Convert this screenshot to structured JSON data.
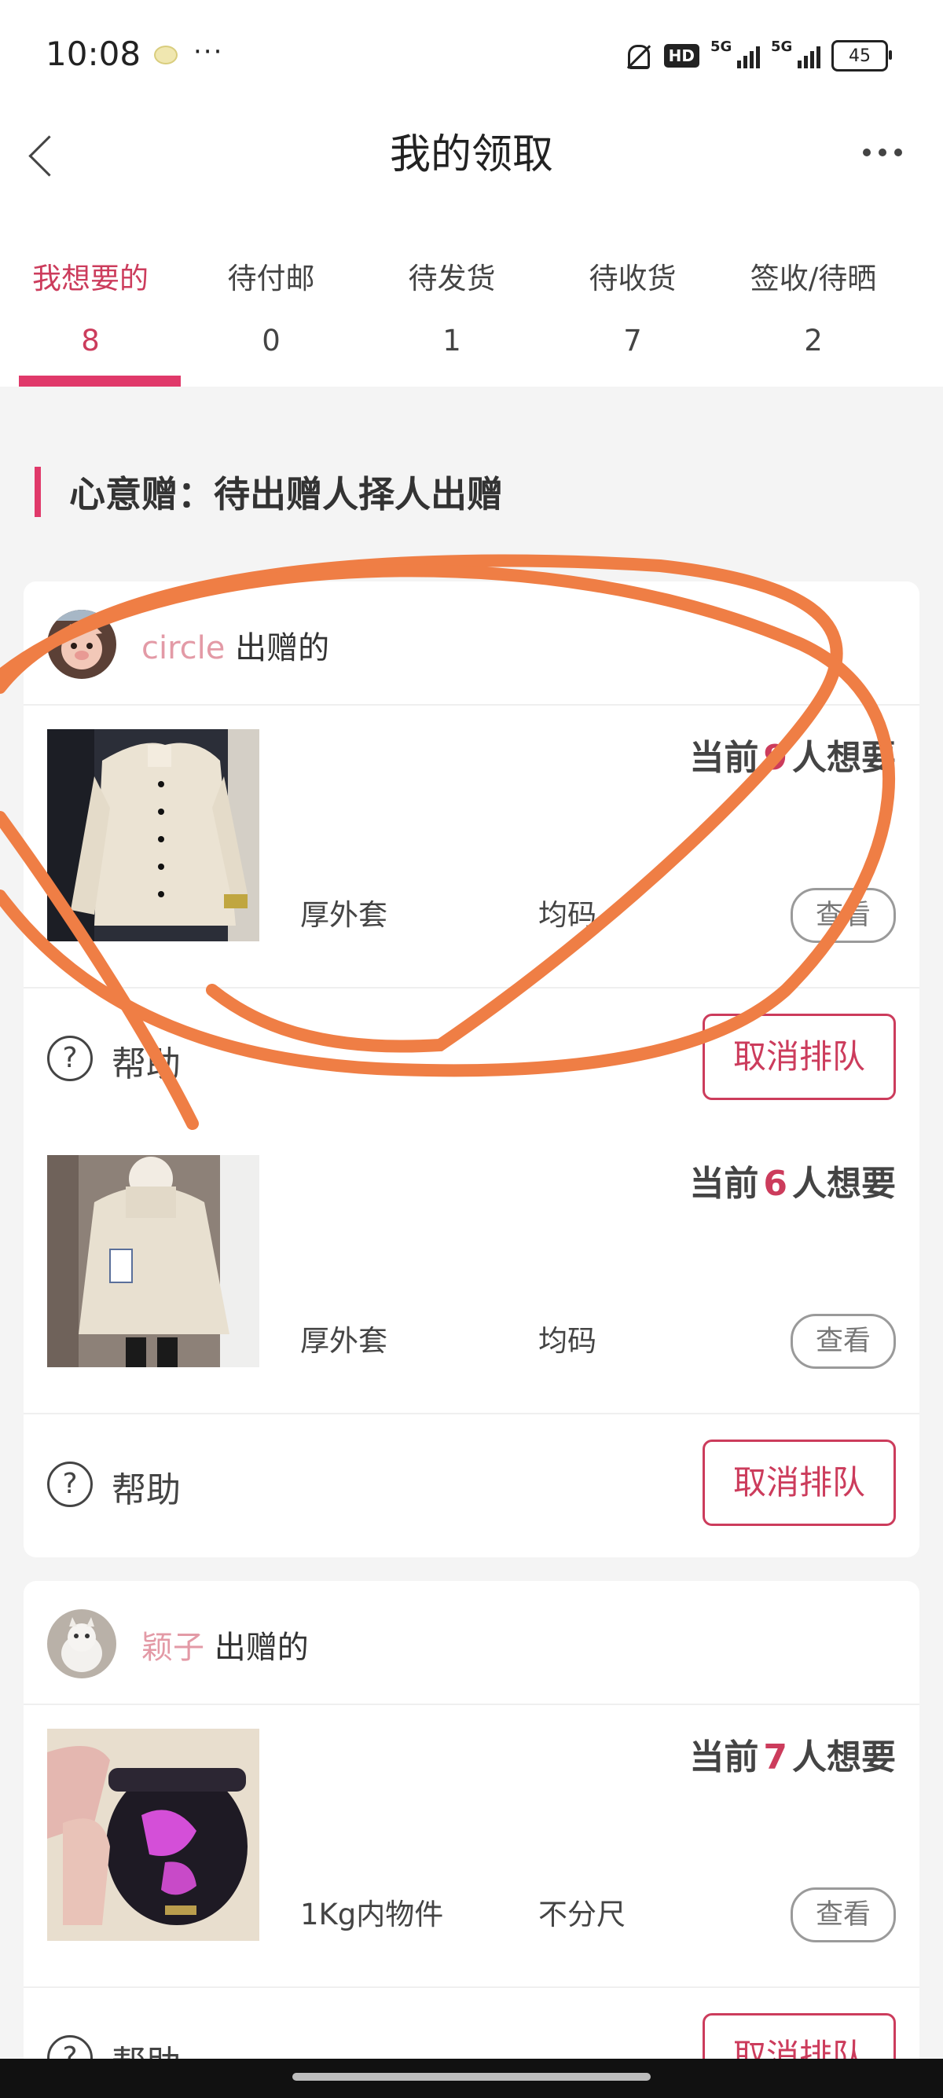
{
  "status_bar": {
    "time": "10:08",
    "dots": "···",
    "hd": "HD",
    "network": "5G",
    "network2": "5G",
    "battery": "45"
  },
  "header": {
    "title": "我的领取"
  },
  "tabs": [
    {
      "label": "我想要的",
      "count": "8",
      "active": true
    },
    {
      "label": "待付邮",
      "count": "0",
      "active": false
    },
    {
      "label": "待发货",
      "count": "1",
      "active": false
    },
    {
      "label": "待收货",
      "count": "7",
      "active": false
    },
    {
      "label": "签收/待晒",
      "count": "2",
      "active": false
    }
  ],
  "section": {
    "title": "心意赠：待出赠人择人出赠"
  },
  "cards": [
    {
      "donor_name": "circle",
      "donor_suffix": "出赠的",
      "items": [
        {
          "want_prefix": "当前",
          "want_count": "9",
          "want_suffix": "人想要",
          "category": "厚外套",
          "size": "均码",
          "view_label": "查看",
          "help_label": "帮助",
          "cancel_label": "取消排队"
        },
        {
          "want_prefix": "当前",
          "want_count": "6",
          "want_suffix": "人想要",
          "category": "厚外套",
          "size": "均码",
          "view_label": "查看",
          "help_label": "帮助",
          "cancel_label": "取消排队"
        }
      ]
    },
    {
      "donor_name": "颖子",
      "donor_suffix": "出赠的",
      "items": [
        {
          "want_prefix": "当前",
          "want_count": "7",
          "want_suffix": "人想要",
          "category": "1Kg内物件",
          "size": "不分尺",
          "view_label": "查看",
          "help_label": "帮助",
          "cancel_label": "取消排队"
        }
      ]
    }
  ],
  "colors": {
    "accent": "#e0396a",
    "accent_text": "#cc3c5c",
    "donor_name": "#e39aa6",
    "annotation": "#ef7e45",
    "background": "#f4f4f4"
  }
}
